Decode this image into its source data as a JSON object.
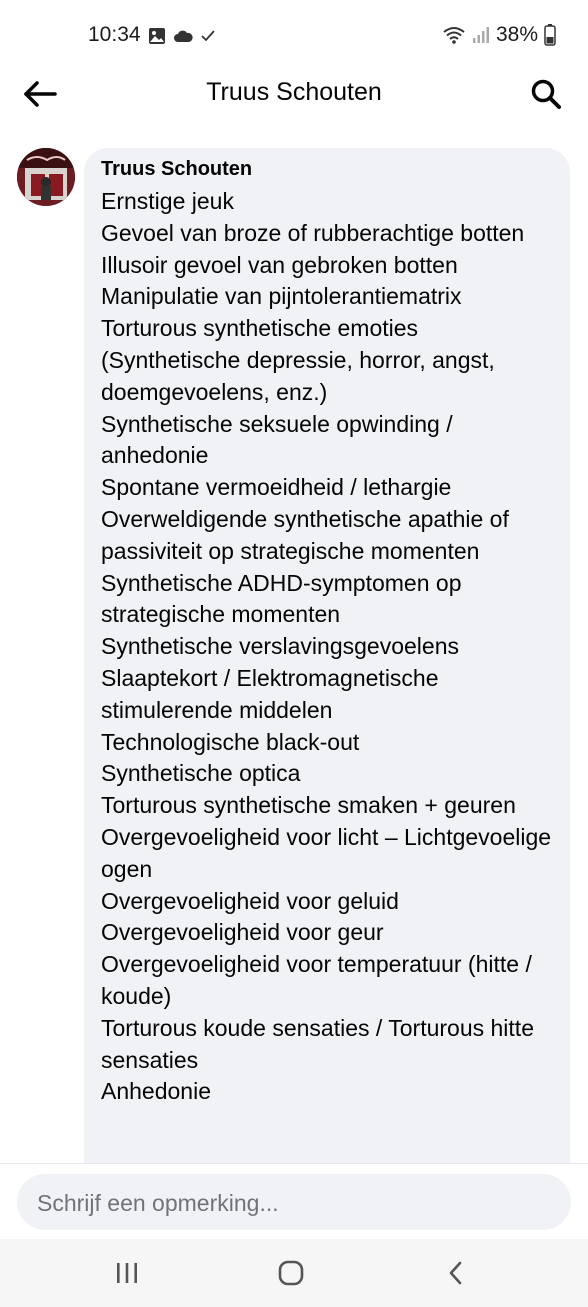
{
  "status_bar": {
    "time": "10:34",
    "battery": "38%",
    "icons": [
      "gallery-icon",
      "cloud-icon",
      "check-icon",
      "wifi-icon",
      "signal-icon",
      "battery-icon"
    ]
  },
  "header": {
    "title": "Truus Schouten",
    "back_icon": "arrow-left-icon",
    "search_icon": "search-icon"
  },
  "comment": {
    "author": "Truus Schouten",
    "lines": [
      "Ernstige jeuk",
      "Gevoel van broze of rubberachtige botten",
      "Illusoir gevoel van gebroken botten",
      "Manipulatie van pijntolerantiematrix",
      "Torturous synthetische emoties (Synthetische depressie, horror, angst, doemgevoelens, enz.)",
      "Synthetische seksuele opwinding / anhedonie",
      "Spontane vermoeidheid / lethargie",
      "Overweldigende synthetische apathie of passiviteit op strategische momenten",
      "Synthetische ADHD-symptomen op strategische momenten",
      "Synthetische verslavingsgevoelens",
      "Slaaptekort / Elektromagnetische stimulerende middelen",
      "Technologische black-out",
      "Synthetische optica",
      "Torturous synthetische smaken + geuren",
      "Overgevoeligheid voor licht – Lichtgevoelige ogen",
      "Overgevoeligheid voor geluid",
      "Overgevoeligheid voor geur",
      "Overgevoeligheid voor temperatuur (hitte / koude)",
      "Torturous koude sensaties / Torturous hitte sensaties",
      "Anhedonie"
    ]
  },
  "composer": {
    "placeholder": "Schrijf een opmerking..."
  },
  "nav_bar": {
    "icons": [
      "recent-apps-icon",
      "home-icon",
      "back-icon"
    ]
  },
  "colors": {
    "bubble": "#f0f2f5",
    "text": "#050505",
    "placeholder": "#70737a"
  }
}
